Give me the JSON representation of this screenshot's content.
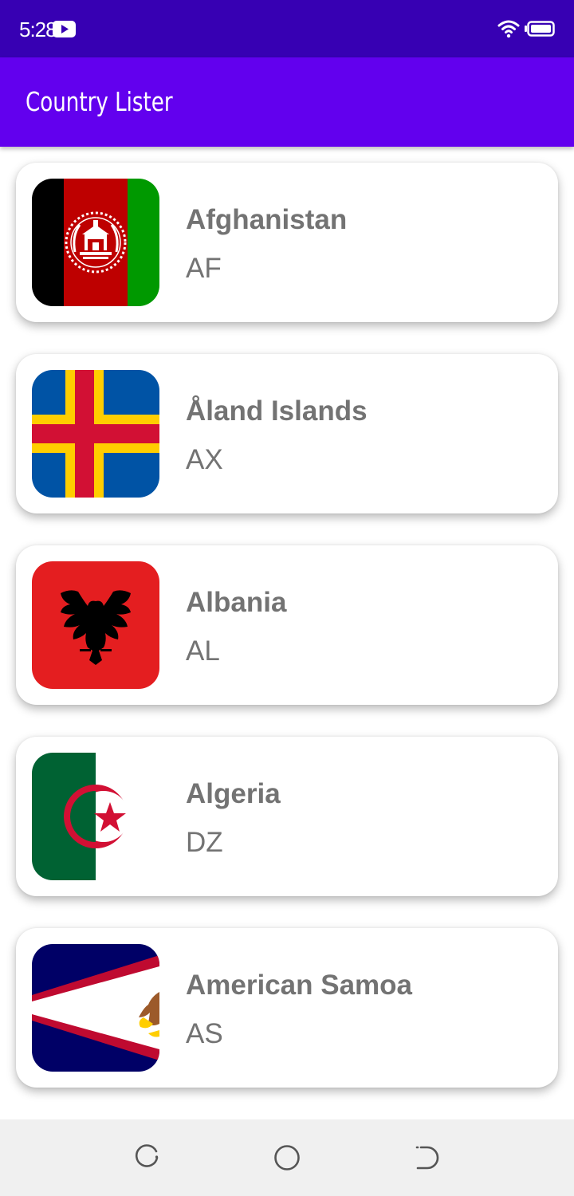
{
  "status_bar": {
    "time": "5:28",
    "icons": [
      "youtube-icon",
      "wifi-icon",
      "battery-icon"
    ]
  },
  "app_bar": {
    "title": "Country Lister"
  },
  "countries": [
    {
      "name": "Afghanistan",
      "code": "AF"
    },
    {
      "name": "Åland Islands",
      "code": "AX"
    },
    {
      "name": "Albania",
      "code": "AL"
    },
    {
      "name": "Algeria",
      "code": "DZ"
    },
    {
      "name": "American Samoa",
      "code": "AS"
    }
  ],
  "nav_bar": {
    "buttons": [
      "recent-apps-icon",
      "home-icon",
      "back-icon"
    ]
  },
  "colors": {
    "status_bar": "#3700b3",
    "app_bar": "#6200ee",
    "card_text": "#737373",
    "nav_bar": "#f0f0f0"
  }
}
